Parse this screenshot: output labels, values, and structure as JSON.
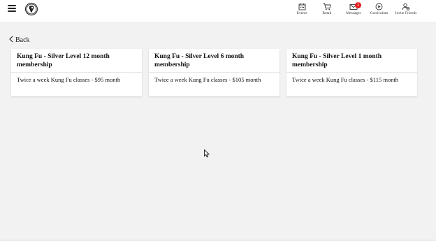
{
  "header": {
    "nav": [
      {
        "label": "Events",
        "icon": "calendar-icon"
      },
      {
        "label": "Retail",
        "icon": "cart-icon"
      },
      {
        "label": "Messages",
        "icon": "envelope-icon",
        "badge": "1"
      },
      {
        "label": "Curriculum",
        "icon": "play-circle-icon"
      },
      {
        "label": "Invite Friends",
        "icon": "add-user-icon"
      }
    ]
  },
  "back_label": "Back",
  "cards": [
    {
      "title": "Kung Fu - Silver Level 12 month membership",
      "description": "Twice a week Kung Fu classes - $95 month"
    },
    {
      "title": "Kung Fu - Silver Level 6 month membership",
      "description": "Twice a week Kung Fu classes - $105 month"
    },
    {
      "title": "Kung Fu -  Silver Level 1 month membership",
      "description": "Twice a week Kung Fu classes - $115 month"
    }
  ],
  "colors": {
    "badge": "#e02020",
    "background": "#f2f2f2",
    "card": "#ffffff"
  }
}
